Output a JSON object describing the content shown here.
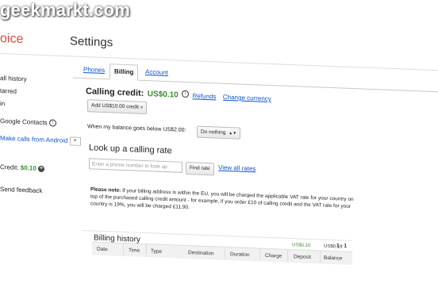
{
  "watermark": "geekmarkt.com",
  "app_name_fragment": "oice",
  "page_title": "Settings",
  "sidebar": {
    "items": [
      {
        "label": "all history"
      },
      {
        "label": "tarred"
      },
      {
        "label": "in"
      },
      {
        "label": "Google Contacts"
      },
      {
        "label": "Make calls from Android"
      }
    ],
    "credit_label": "Credit:",
    "credit_value": "$0.10",
    "feedback": "Send feedback"
  },
  "tabs": [
    {
      "label": "Phones",
      "active": false
    },
    {
      "label": "Billing",
      "active": true
    },
    {
      "label": "Account",
      "active": false
    }
  ],
  "billing": {
    "credit_label": "Calling credit:",
    "credit_value": "US$0.10",
    "refunds": "Refunds",
    "change_currency": "Change currency",
    "add_credit_button": "Add US$10.00 credit »",
    "balance_text": "When my balance goes below US$2.00:",
    "balance_select": "Do nothing",
    "rate_heading": "Look up a calling rate",
    "rate_placeholder": "Enter a phone number to look up",
    "find_rate_button": "Find rate",
    "view_all_rates": "View all rates",
    "note_bold": "Please note:",
    "note_text": " If your billing address is within the EU, you will be charged the applicable VAT rate for your country on top of the purchased calling credit amount - for example, if you order £10 of calling credit and the VAT rate for your country is 19%, you will be charged £11.90.",
    "history_heading": "Billing history",
    "pager": "1 - 1",
    "columns": [
      "Date",
      "Time",
      "Type",
      "Destination",
      "Duration",
      "Charge",
      "Deposit",
      "Balance"
    ],
    "row": {
      "deposit": "US$0.10",
      "balance": "US$0.10"
    }
  },
  "colors": {
    "accent_link": "#1155cc",
    "credit_green": "#3a8d2e",
    "brand_red": "#dd4b39"
  }
}
